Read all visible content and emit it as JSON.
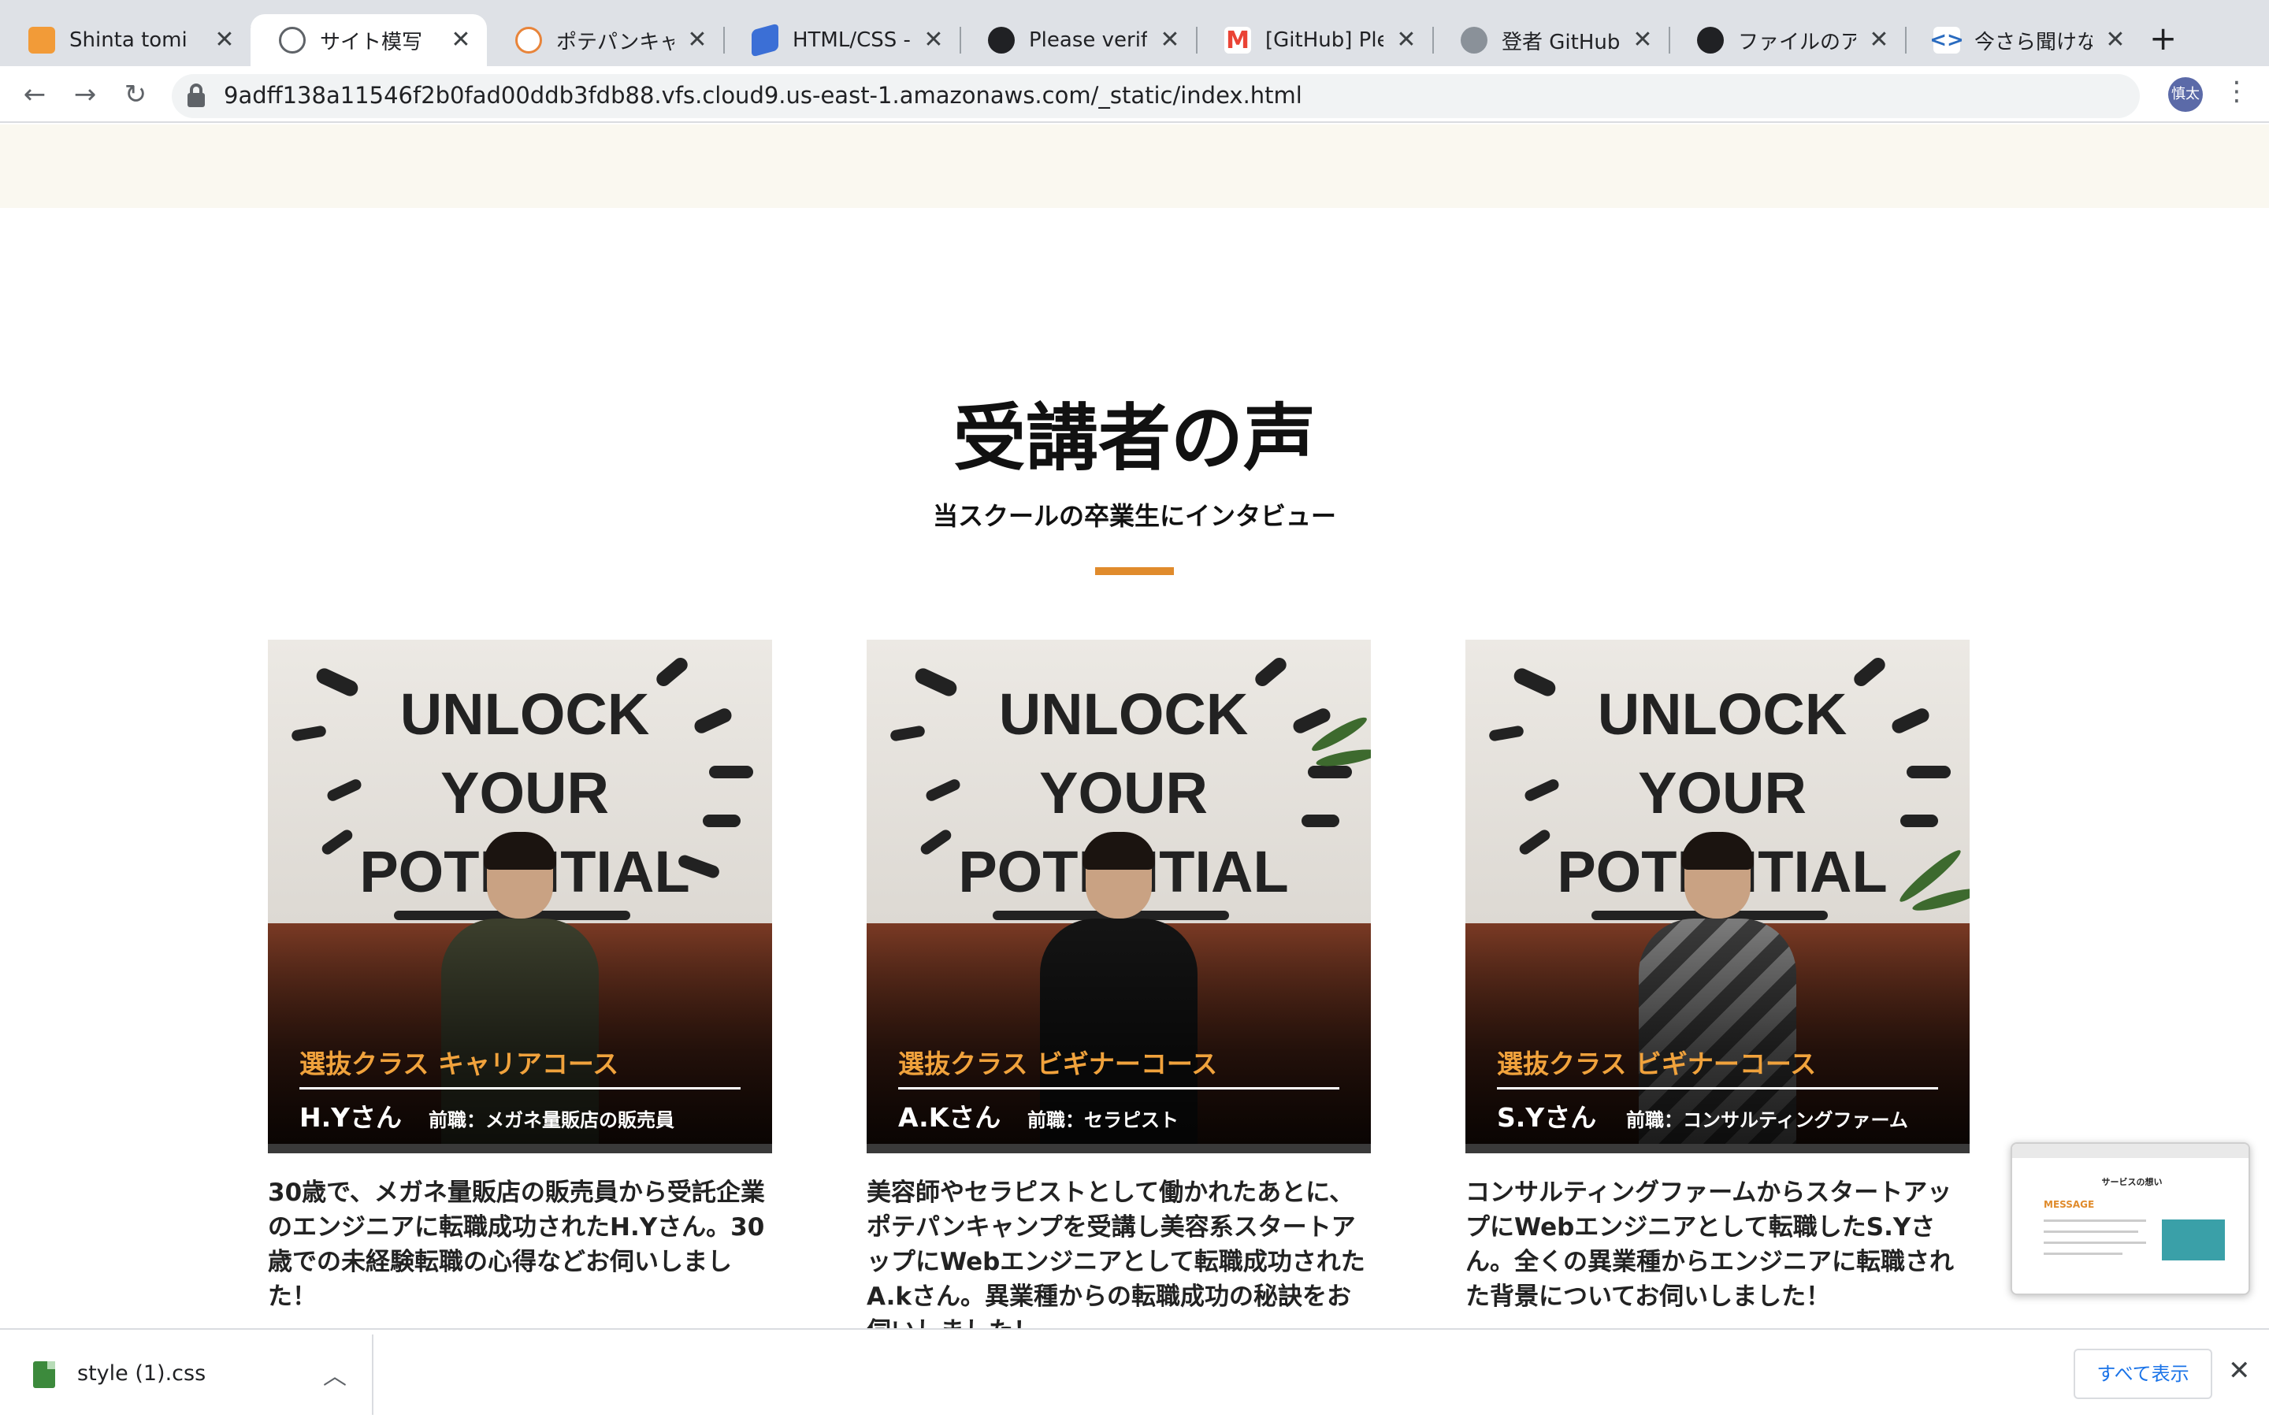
{
  "browser": {
    "tabs": [
      {
        "label": "Shinta tomita - ",
        "icon": "aws-cube-icon",
        "color": "#f29b38"
      },
      {
        "label": "サイト模写",
        "icon": "globe-icon",
        "color": "#5f6368"
      },
      {
        "label": "ポテパンキャンプ",
        "icon": "potepan-icon",
        "color": "#e8843a"
      },
      {
        "label": "HTML/CSS - Ra",
        "icon": "layers-icon",
        "color": "#3b6fd6"
      },
      {
        "label": "Please verify y",
        "icon": "github-icon",
        "color": "#202124"
      },
      {
        "label": "[GitHub] Please",
        "icon": "gmail-icon",
        "color": "#ea4335"
      },
      {
        "label": "登者 GitHubの",
        "icon": "page-icon",
        "color": "#8a9199"
      },
      {
        "label": "ファイルのアップ",
        "icon": "github-icon",
        "color": "#202124"
      },
      {
        "label": "今さら聞けない",
        "icon": "code-icon",
        "color": "#2a6bbf"
      }
    ],
    "active_tab_index": 1,
    "url": "9adff138a11546f2b0fad00ddb3fdb88.vfs.cloud9.us-east-1.amazonaws.com/_static/index.html",
    "profile_initials": "慎太"
  },
  "page": {
    "heading": "受講者の声",
    "subheading": "当スクールの卒業生にインタビュー",
    "accent_color": "#e08b2c",
    "cards": [
      {
        "course": "選抜クラス キャリアコース",
        "name": "H.Yさん",
        "previous": "前職：メガネ量販店の販売員",
        "description": "30歳で、メガネ量販店の販売員から受託企業のエンジニアに転職成功されたH.Yさん。30歳での未経験転職の心得などお伺いしました！",
        "wall_text": [
          "UNLOCK",
          "YOUR",
          "POTENTIAL"
        ]
      },
      {
        "course": "選抜クラス ビギナーコース",
        "name": "A.Kさん",
        "previous": "前職：セラピスト",
        "description": "美容師やセラピストとして働かれたあとに、ポテパンキャンプを受講し美容系スタートアップにWebエンジニアとして転職成功されたA.kさん。異業種からの転職成功の秘訣をお伺いしました！",
        "wall_text": [
          "UNLOCK",
          "YOUR",
          "POTENTIAL"
        ]
      },
      {
        "course": "選抜クラス ビギナーコース",
        "name": "S.Yさん",
        "previous": "前職：コンサルティングファーム",
        "description": "コンサルティングファームからスタートアップにWebエンジニアとして転職したS.Yさん。全くの異業種からエンジニアに転職された背景についてお伺いしました！",
        "wall_text": [
          "UNLOCK",
          "YOUR",
          "POTENTIAL"
        ]
      }
    ]
  },
  "downloads": {
    "file_name": "style (1).css",
    "show_all_label": "すべて表示"
  },
  "pip": {
    "title": "サービスの想い",
    "section": "MESSAGE"
  }
}
